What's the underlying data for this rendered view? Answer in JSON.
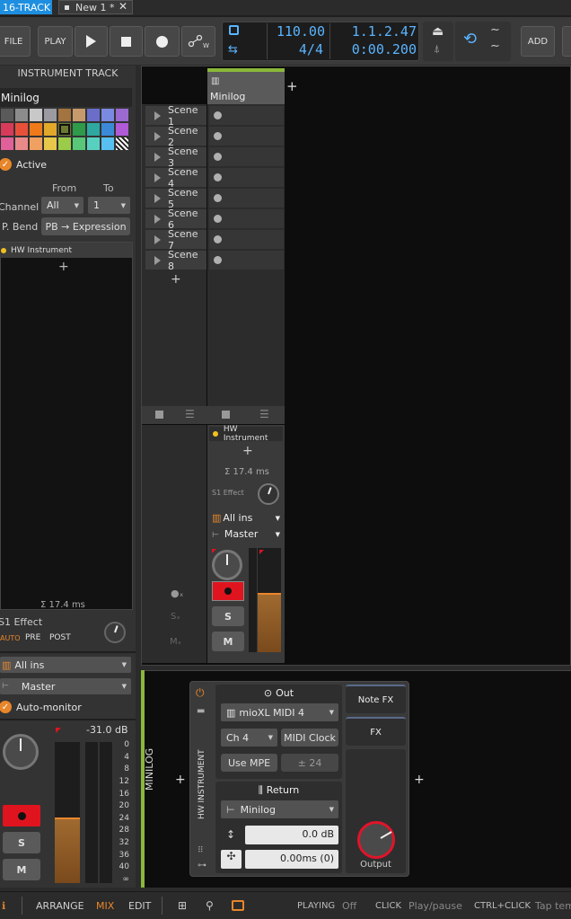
{
  "topbar": {
    "project_tab": "16-TRACK",
    "doc_tab": "New 1 *",
    "file_label": "FILE",
    "play_label": "PLAY",
    "tempo": "110.00",
    "time_sig": "4/4",
    "position_bars": "1.1.2.47",
    "position_time": "0:00.200",
    "add_label": "ADD"
  },
  "inspector": {
    "header": "INSTRUMENT TRACK",
    "track_name": "Minilog",
    "active_label": "Active",
    "from_label": "From",
    "to_label": "To",
    "channel_label": "Channel",
    "channel_from": "All",
    "channel_to": "1",
    "pbend_label": "P. Bend",
    "pbend_value": "PB → Expression",
    "device_label": "HW Instrument",
    "latency": "Σ 17.4 ms",
    "effect_label": "S1 Effect",
    "auto_label": "AUTO",
    "pre_label": "PRE",
    "post_label": "POST",
    "input_value": "All ins",
    "output_value": "Master",
    "automonitor_label": "Auto-monitor",
    "db_value": "-31.0 dB",
    "scale": [
      "0",
      "4",
      "8",
      "12",
      "16",
      "20",
      "24",
      "28",
      "32",
      "36",
      "40",
      "∞"
    ],
    "s_label": "S",
    "m_label": "M",
    "meter_level": 0.45
  },
  "palette": [
    "#5a5a5a",
    "#8c8c8c",
    "#c8c8c8",
    "#9a9aa0",
    "#a3743f",
    "#c79a6b",
    "#6a6ec8",
    "#7a8ae0",
    "#9a6ad0",
    "#d83a5a",
    "#e8503a",
    "#f07a1a",
    "#e2a82a",
    "#6c7a30",
    "#2e9a4a",
    "#2ea8a0",
    "#3a8ad8",
    "#b05ad8",
    "#e0609a",
    "#e88a8a",
    "#f0a060",
    "#e8c84a",
    "#9acc4a",
    "#58c878",
    "#58d0c0",
    "#58c0f0",
    "#hatch"
  ],
  "launcher": {
    "track_name": "Minilog",
    "scenes": [
      "Scene 1",
      "Scene 2",
      "Scene 3",
      "Scene 4",
      "Scene 5",
      "Scene 6",
      "Scene 7",
      "Scene 8"
    ],
    "device_label": "HW Instrument",
    "latency": "Σ 17.4 ms",
    "effect_label": "S1 Effect",
    "input_value": "All ins",
    "output_value": "Master",
    "s_label": "S",
    "m_label": "M",
    "meter_level": 0.55
  },
  "device": {
    "track_label": "MINILOG",
    "device_title": "HW INSTRUMENT",
    "out_label": "Out",
    "midi_port": "mioXL MIDI 4",
    "channel": "Ch 4",
    "midi_clock": "MIDI Clock",
    "use_mpe": "Use MPE",
    "pb_range": "± 24",
    "return_label": "Return",
    "return_source": "Minilog",
    "gain": "0.0 dB",
    "delay": "0.00ms (0)",
    "output_label": "Output",
    "notefx_label": "Note FX",
    "fx_label": "FX"
  },
  "statusbar": {
    "arrange": "ARRANGE",
    "mix": "MIX",
    "edit": "EDIT",
    "playing_label": "PLAYING",
    "playing_value": "Off",
    "click_label": "CLICK",
    "click_value": "Play/pause",
    "ctrlclick_label": "CTRL+CLICK",
    "ctrlclick_value": "Tap tem"
  },
  "colors": {
    "accent_orange": "#e8862a",
    "blue_display": "#5ab4ff",
    "track_green": "#8ab83a",
    "record_red": "#e0141e"
  }
}
